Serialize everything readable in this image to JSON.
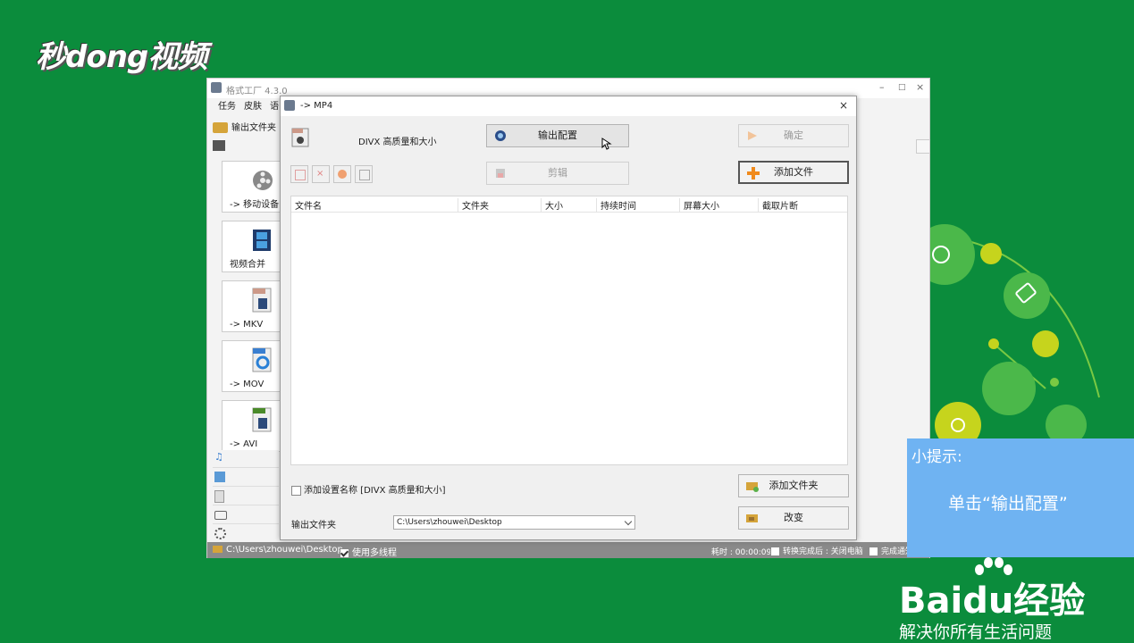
{
  "watermark": {
    "logo_text": "秒dong视频"
  },
  "main_window": {
    "title": "格式工厂 4.3.0",
    "menu": [
      "任务",
      "皮肤",
      "语"
    ],
    "toolbar_output_folder": "输出文件夹",
    "sidebar_items": [
      {
        "label": "-> 移动设备",
        "icon": "film-reel-icon"
      },
      {
        "label": "视频合并",
        "icon": "film-strip-icon"
      },
      {
        "label": "-> MKV",
        "icon": "mkv-file-icon"
      },
      {
        "label": "-> MOV",
        "icon": "mov-file-icon"
      },
      {
        "label": "-> AVI",
        "icon": "avi-file-icon"
      }
    ],
    "categories": [
      "music-icon",
      "picture-icon",
      "document-icon",
      "disc-icon",
      "tools-icon"
    ],
    "status": {
      "path": "C:\\Users\\zhouwei\\Desktop",
      "multithread_label": "使用多线程",
      "multithread_checked": true,
      "elapsed": "耗时 : 00:00:09",
      "after_convert": "转换完成后 : 关闭电脑",
      "notify": "完成通知"
    }
  },
  "dialog": {
    "title": "-> MP4",
    "preset": "DIVX 高质量和大小",
    "output_config_button": "输出配置",
    "ok_button": "确定",
    "clip_button": "剪辑",
    "add_file_button": "添加文件",
    "columns": [
      "文件名",
      "文件夹",
      "大小",
      "持续时间",
      "屏幕大小",
      "截取片断"
    ],
    "add_setting_name_label": "添加设置名称 [DIVX 高质量和大小]",
    "add_folder_button": "添加文件夹",
    "output_folder_label": "输出文件夹",
    "output_folder_value": "C:\\Users\\zhouwei\\Desktop",
    "change_button": "改变"
  },
  "tip": {
    "heading": "小提示:",
    "body": "单击“输出配置”"
  },
  "baidu": {
    "logo": "Baidu经验",
    "slogan": "解决你所有生活问题"
  }
}
